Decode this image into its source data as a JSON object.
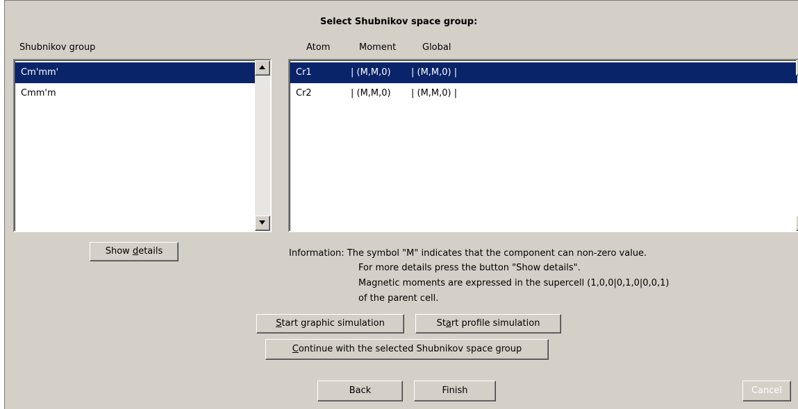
{
  "dialog": {
    "title": "Select Shubnikov space group:"
  },
  "groups": {
    "header": "Shubnikov  group",
    "items": [
      "Cm'mm'",
      "Cmm'm"
    ],
    "selected_index": 0
  },
  "atoms": {
    "columns": [
      "Atom",
      "Moment",
      "Global"
    ],
    "rows": [
      {
        "atom": "Cr1",
        "moment": "|  (M,M,0)",
        "global": "|  (M,M,0)  |"
      },
      {
        "atom": "Cr2",
        "moment": "|  (M,M,0)",
        "global": "|  (M,M,0)  |"
      }
    ],
    "selected_index": 0
  },
  "info": {
    "line1": "Information: The symbol \"M\" indicates that the component can  non-zero value.",
    "line2": "For more details press the button \"Show details\".",
    "line3": "Magnetic moments are expressed in the supercell (1,0,0|0,1,0|0,0,1)",
    "line4": "of the parent cell."
  },
  "buttons": {
    "show_details": {
      "pre": "Show ",
      "mnemonic": "d",
      "post": "etails"
    },
    "start_graphic": {
      "pre": "",
      "mnemonic": "S",
      "post": "tart graphic simulation"
    },
    "start_profile": {
      "pre": "St",
      "mnemonic": "a",
      "post": "rt profile simulation"
    },
    "continue": {
      "pre": "",
      "mnemonic": "C",
      "post": "ontinue with the selected Shubnikov space group"
    },
    "back": "Back",
    "finish": "Finish",
    "cancel": "Cancel"
  },
  "icons": {
    "scroll_up": "arrow-up-icon",
    "scroll_down": "arrow-down-icon"
  },
  "colors": {
    "panel_bg": "#d4d0c8",
    "selection_bg": "#0a246a",
    "selection_fg": "#ffffff"
  }
}
